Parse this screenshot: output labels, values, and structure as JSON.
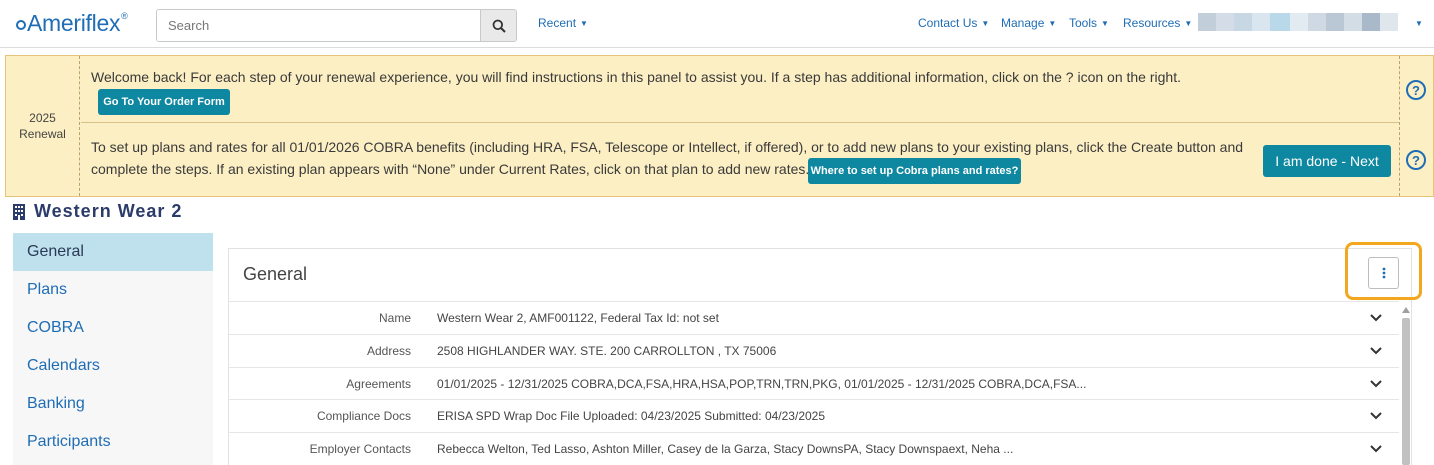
{
  "brand": {
    "name": "Ameriflex",
    "mark": "®"
  },
  "search": {
    "placeholder": "Search"
  },
  "nav": {
    "recent": "Recent",
    "contact_us": "Contact Us",
    "manage": "Manage",
    "tools": "Tools",
    "resources": "Resources"
  },
  "renewal": {
    "year": "2025",
    "label": "Renewal",
    "step1_text": "Welcome back! For each step of your renewal experience, you will find instructions in this panel to assist you. If a step has additional information, click on the ? icon on the right.",
    "order_form_button": "Go To Your Order Form",
    "step2_text_line1": "To set up plans and rates for all 01/01/2026 COBRA benefits (including HRA, FSA, Telescope or Intellect, if offered), or to add new plans to your existing plans, click the Create button and",
    "step2_text_line2": "complete the steps. If an existing plan appears with “None” under Current Rates, click on that plan to add new rates.",
    "cobra_button": "Where to set up Cobra plans and rates?",
    "done_button": "I am done - Next",
    "help_glyph": "?"
  },
  "employer": {
    "name": "Western Wear 2"
  },
  "sidebar": {
    "items": [
      {
        "label": "General"
      },
      {
        "label": "Plans"
      },
      {
        "label": "COBRA"
      },
      {
        "label": "Calendars"
      },
      {
        "label": "Banking"
      },
      {
        "label": "Participants"
      }
    ]
  },
  "general": {
    "title": "General",
    "rows": [
      {
        "key": "Name",
        "value": "Western Wear 2, AMF001122, Federal Tax Id: not set"
      },
      {
        "key": "Address",
        "value": "2508 HIGHLANDER WAY. STE. 200 CARROLLTON , TX 75006"
      },
      {
        "key": "Agreements",
        "value": "01/01/2025 - 12/31/2025 COBRA,DCA,FSA,HRA,HSA,POP,TRN,TRN,PKG, 01/01/2025 - 12/31/2025 COBRA,DCA,FSA..."
      },
      {
        "key": "Compliance Docs",
        "value": "ERISA SPD Wrap Doc File Uploaded: 04/23/2025 Submitted: 04/23/2025"
      },
      {
        "key": "Employer Contacts",
        "value": "Rebecca Welton, Ted Lasso, Ashton Miller, Casey de la Garza, Stacy DownsPA, Stacy Downspaext, Neha ..."
      }
    ]
  },
  "colors": {
    "brand_blue": "#1f6db5",
    "teal": "#0e87a0",
    "panel_yellow": "#fcefc4",
    "highlight_orange": "#f2a71f",
    "active_nav": "#bfe1ee"
  },
  "icons": {
    "search": "search-icon",
    "building": "building-icon",
    "help": "help-circle-icon",
    "kebab": "kebab-menu-icon",
    "chevron": "chevron-down-icon"
  }
}
